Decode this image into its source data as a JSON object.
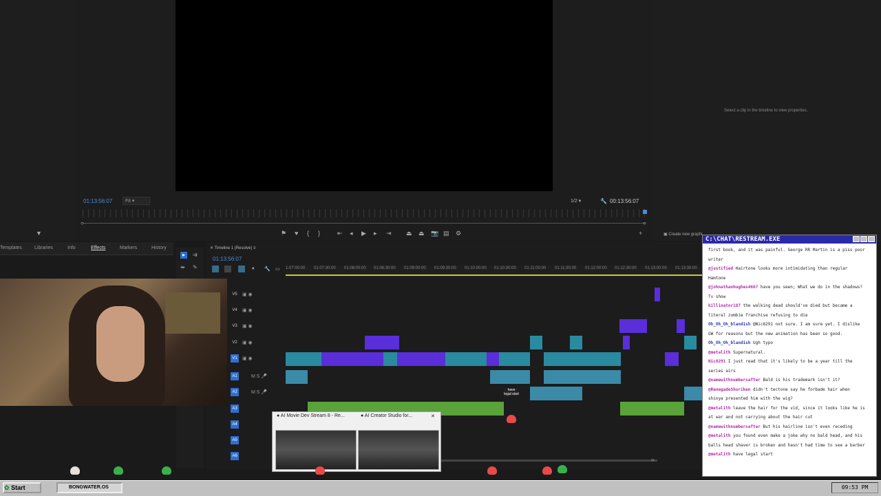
{
  "monitor": {
    "timecode_left": "01:13:56:07",
    "fit_label": "Fit",
    "resolution_label": "1/2",
    "timecode_right": "00:13:56:07"
  },
  "properties": {
    "hint_text": "Select a clip in the timeline to view properties.",
    "create_graphic_label": "Create new graphi"
  },
  "panel_tabs": [
    "Templates",
    "Libraries",
    "Info",
    "Effects",
    "Markers",
    "History"
  ],
  "timeline": {
    "title": "Timeline 1 (Resolve)",
    "timecode": "01:13:56:07",
    "ruler_ticks": [
      "1:07:00:00",
      "01:07:30:00",
      "01:08:00:00",
      "01:08:30:00",
      "01:09:00:00",
      "01:09:30:00",
      "01:10:00:00",
      "01:10:30:00",
      "01:11:00:00",
      "01:11:30:00",
      "01:12:00:00",
      "01:12:30:00",
      "01:13:00:00",
      "01:13:30:00"
    ],
    "tracks": [
      "V5",
      "V4",
      "V3",
      "V2",
      "V1",
      "A1",
      "A2",
      "A3",
      "A4",
      "A5",
      "A6"
    ],
    "overlay_note": "have legal start"
  },
  "popup": {
    "tab1": "AI Movie Dev Stream 8 - Re...",
    "tab2": "AI Creator Studio for..."
  },
  "chat": {
    "title": "C:\\CHAT\\RESTREAM.EXE",
    "messages": [
      {
        "user": "",
        "text": "first book, and it was painful. George RR Martin is a piss poor writer"
      },
      {
        "user": "@justified",
        "text": " Hairtone looks more intimidating than regular Hamtone"
      },
      {
        "user": "@johnathanhughes4667",
        "text": " have you seen; What we do in the shadows? Tv show"
      },
      {
        "user": "killinator187",
        "text": " the walking dead should've died but became a literal zombie franchise refusing to die"
      },
      {
        "user": "Oh_Oh_Oh_blandish",
        "text": " @Nic8291 not sure. I am sure yet. I dislike GW for reasons but the new animation has been so good."
      },
      {
        "user": "Oh_Oh_Oh_blandish",
        "text": " Ugh typo"
      },
      {
        "user": "@metalith",
        "text": " Supernatural."
      },
      {
        "user": "Nic8291",
        "text": " I just read that it's likely to be a year till the series airs"
      },
      {
        "user": "@namewithnumbersafter",
        "text": " Bald is his trademark isn't it?"
      },
      {
        "user": "@RenegadeShuriken",
        "text": " didn't tectone say he forbade hair when shinya presented him with the wig?"
      },
      {
        "user": "@metalith",
        "text": " leave the hair for the vid, since it looks like he is at war and not carrying about the hair cut"
      },
      {
        "user": "@namewithnumbersafter",
        "text": " But his hairline isn't even receding"
      },
      {
        "user": "@metalith",
        "text": " you found even make a joke why no bald head, and his balls head shaver is broken and hasn't had time to see a barber"
      },
      {
        "user": "@metalith",
        "text": " have legal start"
      }
    ]
  },
  "taskbar": {
    "start_label": "Start",
    "task_label": "BONGWATER.OS",
    "clock": "09:53 PM"
  },
  "colors": {
    "accent_blue": "#2e6fcf",
    "clip_teal": "#2a8aa0",
    "clip_purple": "#5a2ed8",
    "clip_green": "#5aa33a",
    "chat_title_bg": "#2a2aa8"
  }
}
